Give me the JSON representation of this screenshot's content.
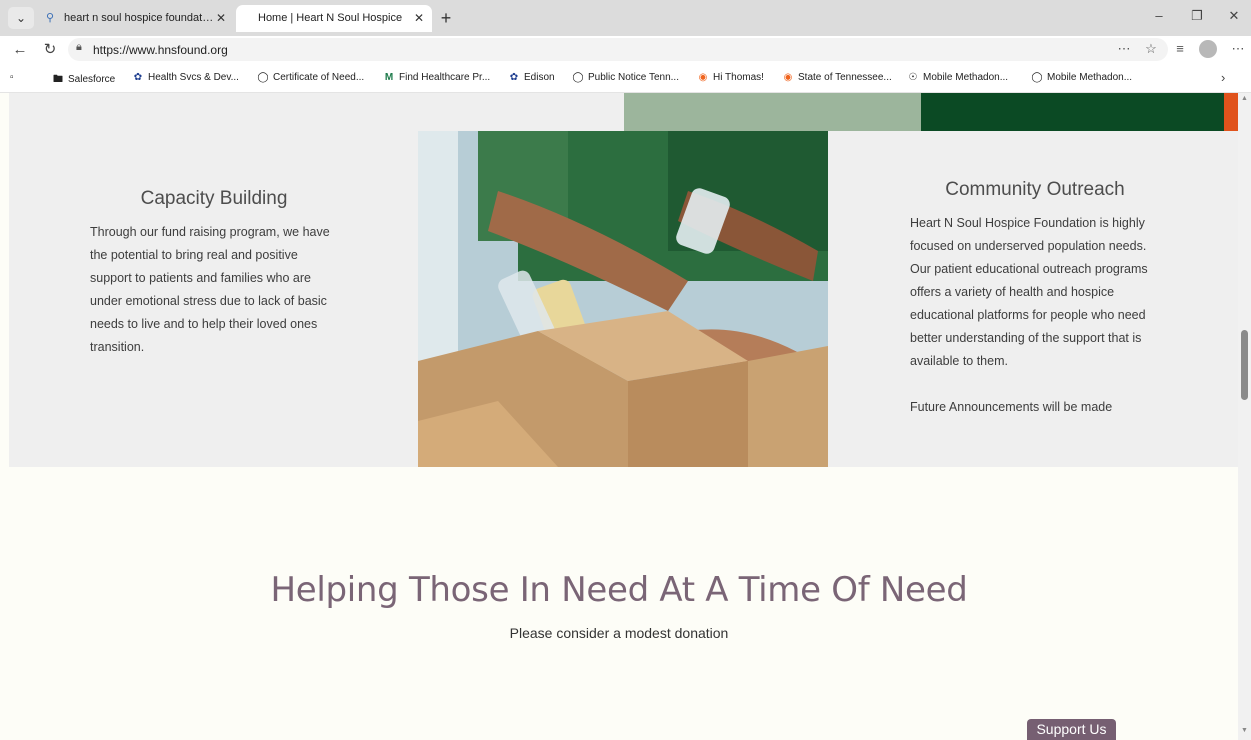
{
  "browser": {
    "tabs": [
      {
        "label": "heart n soul hospice foundation -",
        "icon": "search-icon",
        "active": false
      },
      {
        "label": "Home | Heart N Soul Hospice",
        "icon": "none",
        "active": true
      }
    ],
    "url": "https://www.hnsfound.org",
    "bookmarks": [
      {
        "label": "Salesforce",
        "icon": "folder-icon"
      },
      {
        "label": "Health Svcs & Dev...",
        "icon": "state-seal-icon"
      },
      {
        "label": "Certificate of Need...",
        "icon": "globe-icon"
      },
      {
        "label": "Find Healthcare Pr...",
        "icon": "m-logo-icon"
      },
      {
        "label": "Edison",
        "icon": "state-seal-icon"
      },
      {
        "label": "Public Notice Tenn...",
        "icon": "globe-icon"
      },
      {
        "label": "Hi Thomas!",
        "icon": "orange-ring-icon"
      },
      {
        "label": "State of Tennessee...",
        "icon": "orange-ring-icon"
      },
      {
        "label": "Mobile Methadon...",
        "icon": "circle-logo-icon"
      },
      {
        "label": "Mobile Methadon...",
        "icon": "globe-icon"
      }
    ],
    "colors": {
      "tabbar": "#dcdcdc",
      "active_tab": "#ffffff"
    }
  },
  "page": {
    "capacity": {
      "title": "Capacity Building",
      "body": "Through our fund raising program, we have the potential to bring real and positive support to patients and families who are under emotional stress due to lack of basic needs to live and to help their loved ones transition."
    },
    "outreach": {
      "title": "Community Outreach",
      "body": "Heart N Soul Hospice Foundation is highly focused on underserved population needs. Our patient educational outreach programs offers a variety of health and hospice educational platforms for people who need better understanding of the support that is available to them.",
      "note": "Future Announcements will be made"
    },
    "headline": "Helping Those In Need At A Time Of Need",
    "subline": "Please consider a modest donation",
    "support_button": "Support Us",
    "colors": {
      "band_bg": "#efefef",
      "page_bg": "#fdfdf7",
      "headline": "#7a6576",
      "support_button_bg": "#765f72",
      "deco_sage": "#9cb59c",
      "deco_green": "#0b4a24",
      "deco_orange": "#e0531c"
    }
  }
}
